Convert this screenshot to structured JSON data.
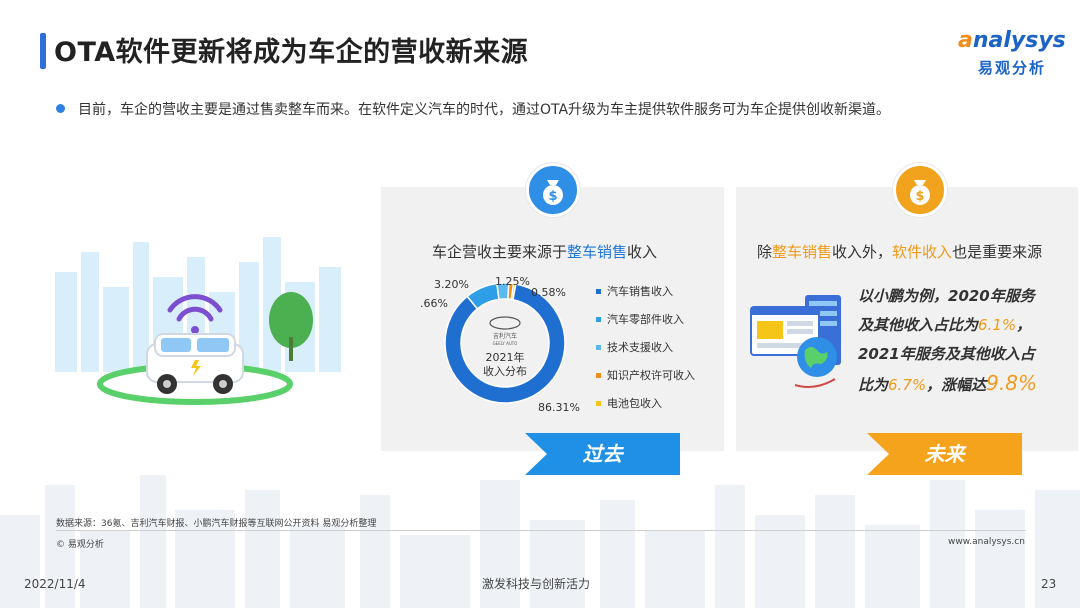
{
  "title": "OTA软件更新将成为车企的营收新来源",
  "logo": {
    "en_prefix": "a",
    "en_rest": "nalysys",
    "cn": "易观分析"
  },
  "bullet": "目前，车企的营收主要是通过售卖整车而来。在软件定义汽车的时代，通过OTA升级为车主提供软件服务可为车企提供创收新渠道。",
  "past": {
    "heading_pre": "车企营收主要来源于",
    "heading_hl": "整车销售",
    "heading_post": "收入",
    "donut_center_line1": "2021年",
    "donut_center_line2": "收入分布",
    "brand_cn": "吉利汽车",
    "brand_en": "GEELY AUTO",
    "segments": [
      {
        "name": "汽车销售收入",
        "value": 86.31,
        "label": "86.31%",
        "color": "#1f6fd1"
      },
      {
        "name": "汽车零部件收入",
        "value": 8.66,
        "label": "8.66%",
        "color": "#2f9ee8"
      },
      {
        "name": "技术支援收入",
        "value": 3.2,
        "label": "3.20%",
        "color": "#5cb8f0"
      },
      {
        "name": "知识产权许可收入",
        "value": 1.25,
        "label": "1.25%",
        "color": "#f08c1a"
      },
      {
        "name": "电池包收入",
        "value": 0.58,
        "label": "0.58%",
        "color": "#f5c518"
      }
    ],
    "tag": "过去"
  },
  "future": {
    "heading_pre": "除",
    "heading_hl1": "整车销售",
    "heading_mid": "收入外，",
    "heading_hl2": "软件收入",
    "heading_post": "也是重要来源",
    "line1": "以小鹏为例，2020年服务",
    "line2_pre": "及其他收入占比为",
    "line2_hl": "6.1%",
    "line2_post": "，",
    "line3": "2021年服务及其他收入占",
    "line4_pre": "比为",
    "line4_hl": "6.7%",
    "line4_mid": "，涨幅达",
    "line4_big": "9.8%",
    "tag": "未来"
  },
  "colors": {
    "accent_blue": "#1f78d6",
    "accent_orange": "#f09a1a"
  },
  "footer": {
    "source": "数据来源：36氪、吉利汽车财报、小鹏汽车财报等互联网公开资料  易观分析整理",
    "copyright": "© 易观分析",
    "site": "www.analysys.cn",
    "date": "2022/11/4",
    "slogan": "激发科技与创新活力",
    "page": "23"
  }
}
